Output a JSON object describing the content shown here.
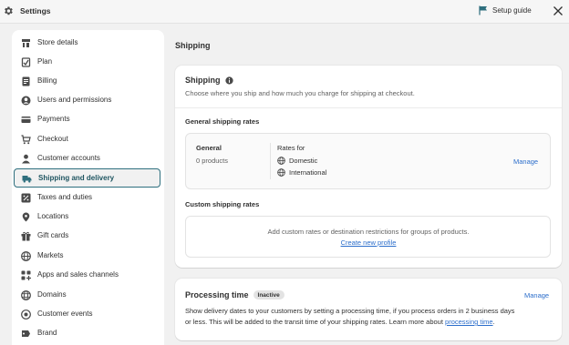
{
  "topbar": {
    "title": "Settings",
    "setup_guide": "Setup guide"
  },
  "sidebar": {
    "items": [
      {
        "label": "Store details",
        "icon": "store-icon"
      },
      {
        "label": "Plan",
        "icon": "plan-icon"
      },
      {
        "label": "Billing",
        "icon": "billing-icon"
      },
      {
        "label": "Users and permissions",
        "icon": "user-icon"
      },
      {
        "label": "Payments",
        "icon": "payments-icon"
      },
      {
        "label": "Checkout",
        "icon": "cart-icon"
      },
      {
        "label": "Customer accounts",
        "icon": "customer-icon"
      },
      {
        "label": "Shipping and delivery",
        "icon": "truck-icon",
        "active": true
      },
      {
        "label": "Taxes and duties",
        "icon": "tax-icon"
      },
      {
        "label": "Locations",
        "icon": "location-icon"
      },
      {
        "label": "Gift cards",
        "icon": "gift-icon"
      },
      {
        "label": "Markets",
        "icon": "globe-icon"
      },
      {
        "label": "Apps and sales channels",
        "icon": "apps-icon"
      },
      {
        "label": "Domains",
        "icon": "domains-icon"
      },
      {
        "label": "Customer events",
        "icon": "events-icon"
      },
      {
        "label": "Brand",
        "icon": "brand-icon"
      }
    ]
  },
  "main": {
    "page_title": "Shipping",
    "shipping_card": {
      "title": "Shipping",
      "subtitle": "Choose where you ship and how much you charge for shipping at checkout.",
      "general_rates_label": "General shipping rates",
      "profile": {
        "name": "General",
        "count": "0 products",
        "rates_for": "Rates for",
        "zones": [
          "Domestic",
          "International"
        ],
        "manage": "Manage"
      },
      "custom_rates_label": "Custom shipping rates",
      "custom_text": "Add custom rates or destination restrictions for groups of products.",
      "create_profile": "Create new profile"
    },
    "processing_card": {
      "title": "Processing time",
      "badge": "Inactive",
      "manage": "Manage",
      "desc_line1": "Show delivery dates to your customers by setting a processing time, if you process orders in 2 business days",
      "desc_line2": "or less. This will be added to the transit time of your shipping rates. Learn more about",
      "desc_link": "processing time",
      "desc_end": "."
    }
  }
}
